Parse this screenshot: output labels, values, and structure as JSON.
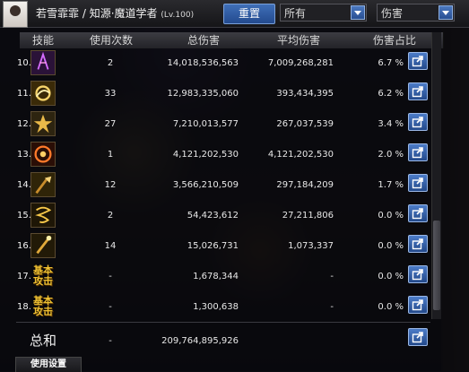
{
  "header": {
    "character_name": "若雪霏霏",
    "separator": "/",
    "class_name": "知源·魔道学者",
    "level": "(Lv.100)",
    "reset_label": "重置",
    "filter_value": "所有",
    "sort_value": "伤害"
  },
  "columns": {
    "skill": "技能",
    "count": "使用次数",
    "total": "总伤害",
    "avg": "平均伤害",
    "pct": "伤害占比"
  },
  "rows": [
    {
      "index": "10.",
      "icon": "purple-rune-skill-icon",
      "count": "2",
      "total": "14,018,536,563",
      "avg": "7,009,268,281",
      "pct": "6.7 %"
    },
    {
      "index": "11.",
      "icon": "golden-swirl-skill-icon",
      "count": "33",
      "total": "12,983,335,060",
      "avg": "393,434,395",
      "pct": "6.2 %"
    },
    {
      "index": "12.",
      "icon": "golden-burst-skill-icon",
      "count": "27",
      "total": "7,210,013,577",
      "avg": "267,037,539",
      "pct": "3.4 %"
    },
    {
      "index": "13.",
      "icon": "fire-orb-skill-icon",
      "count": "1",
      "total": "4,121,202,530",
      "avg": "4,121,202,530",
      "pct": "2.0 %"
    },
    {
      "index": "14.",
      "icon": "broom-skill-icon",
      "count": "12",
      "total": "3,566,210,509",
      "avg": "297,184,209",
      "pct": "1.7 %"
    },
    {
      "index": "15.",
      "icon": "whirlwind-skill-icon",
      "count": "2",
      "total": "54,423,612",
      "avg": "27,211,806",
      "pct": "0.0 %"
    },
    {
      "index": "16.",
      "icon": "staff-strike-skill-icon",
      "count": "14",
      "total": "15,026,731",
      "avg": "1,073,337",
      "pct": "0.0 %"
    },
    {
      "index": "17.",
      "icon": "basic-attack-icon",
      "icon_text": "基本攻击",
      "count": "-",
      "total": "1,678,344",
      "avg": "-",
      "pct": "0.0 %"
    },
    {
      "index": "18.",
      "icon": "basic-attack-icon",
      "icon_text": "基本攻击",
      "count": "-",
      "total": "1,300,638",
      "avg": "-",
      "pct": "0.0 %"
    }
  ],
  "summary": {
    "label": "总和",
    "count": "-",
    "total": "209,764,895,926"
  },
  "bottom_tab": "使用设置",
  "colors": {
    "accent_blue": "#2f5ea6",
    "gold": "#f1c232",
    "text": "#e8e8e8"
  }
}
